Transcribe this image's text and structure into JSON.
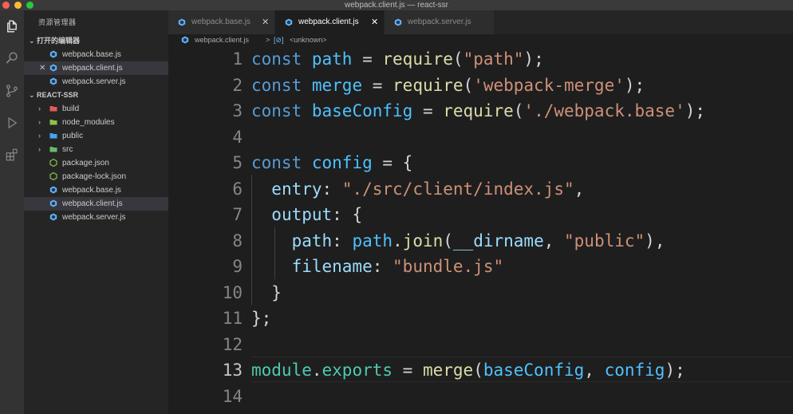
{
  "window": {
    "title": "webpack.client.js — react-ssr"
  },
  "sidebar": {
    "header": "资源管理器",
    "open_editors": {
      "title": "打开的编辑器",
      "items": [
        {
          "label": "webpack.base.js"
        },
        {
          "label": "webpack.client.js"
        },
        {
          "label": "webpack.server.js"
        }
      ],
      "close_glyph": "✕"
    },
    "project": {
      "title": "REACT-SSR",
      "items": [
        {
          "label": "build",
          "kind": "folder",
          "color": "#e05c5c"
        },
        {
          "label": "node_modules",
          "kind": "folder",
          "color": "#8bc34a"
        },
        {
          "label": "public",
          "kind": "folder",
          "color": "#42a5f5"
        },
        {
          "label": "src",
          "kind": "folder",
          "color": "#66bb6a"
        },
        {
          "label": "package.json",
          "kind": "file",
          "color": "#8bc34a"
        },
        {
          "label": "package-lock.json",
          "kind": "file",
          "color": "#8bc34a"
        },
        {
          "label": "webpack.base.js",
          "kind": "file",
          "color": "#64b5f6"
        },
        {
          "label": "webpack.client.js",
          "kind": "file",
          "color": "#64b5f6"
        },
        {
          "label": "webpack.server.js",
          "kind": "file",
          "color": "#64b5f6"
        }
      ]
    }
  },
  "tabs": [
    {
      "label": "webpack.base.js",
      "active": false
    },
    {
      "label": "webpack.client.js",
      "active": true
    },
    {
      "label": "webpack.server.js",
      "active": false
    }
  ],
  "tab_close_glyph": "✕",
  "breadcrumb": {
    "file": "webpack.client.js",
    "separator": ">",
    "symbol_icon": "[⊘]",
    "symbol": "<unknown>"
  },
  "activity_icons": [
    "files-icon",
    "search-icon",
    "source-control-icon",
    "run-debug-icon",
    "extensions-icon"
  ],
  "editor": {
    "line_numbers": [
      "1",
      "2",
      "3",
      "4",
      "5",
      "6",
      "7",
      "8",
      "9",
      "10",
      "11",
      "12",
      "13",
      "14"
    ],
    "lines": [
      [
        [
          "kw",
          "const"
        ],
        [
          "pl",
          " "
        ],
        [
          "var",
          "path"
        ],
        [
          "pl",
          " = "
        ],
        [
          "fn",
          "require"
        ],
        [
          "pl",
          "("
        ],
        [
          "str",
          "\"path\""
        ],
        [
          "pl",
          ");"
        ]
      ],
      [
        [
          "kw",
          "const"
        ],
        [
          "pl",
          " "
        ],
        [
          "var",
          "merge"
        ],
        [
          "pl",
          " = "
        ],
        [
          "fn",
          "require"
        ],
        [
          "pl",
          "("
        ],
        [
          "str",
          "'webpack-merge'"
        ],
        [
          "pl",
          ");"
        ]
      ],
      [
        [
          "kw",
          "const"
        ],
        [
          "pl",
          " "
        ],
        [
          "var",
          "baseConfig"
        ],
        [
          "pl",
          " = "
        ],
        [
          "fn",
          "require"
        ],
        [
          "pl",
          "("
        ],
        [
          "str",
          "'./webpack.base'"
        ],
        [
          "pl",
          ");"
        ]
      ],
      [],
      [
        [
          "kw",
          "const"
        ],
        [
          "pl",
          " "
        ],
        [
          "var",
          "config"
        ],
        [
          "pl",
          " = {"
        ]
      ],
      [
        [
          "pl",
          "  "
        ],
        [
          "prop",
          "entry"
        ],
        [
          "pl",
          ": "
        ],
        [
          "str",
          "\"./src/client/index.js\""
        ],
        [
          "pl",
          ","
        ]
      ],
      [
        [
          "pl",
          "  "
        ],
        [
          "prop",
          "output"
        ],
        [
          "pl",
          ": {"
        ]
      ],
      [
        [
          "pl",
          "    "
        ],
        [
          "prop",
          "path"
        ],
        [
          "pl",
          ": "
        ],
        [
          "var",
          "path"
        ],
        [
          "pl",
          "."
        ],
        [
          "fn",
          "join"
        ],
        [
          "pl",
          "("
        ],
        [
          "prop",
          "__dirname"
        ],
        [
          "pl",
          ", "
        ],
        [
          "str",
          "\"public\""
        ],
        [
          "pl",
          "),"
        ]
      ],
      [
        [
          "pl",
          "    "
        ],
        [
          "prop",
          "filename"
        ],
        [
          "pl",
          ": "
        ],
        [
          "str",
          "\"bundle.js\""
        ]
      ],
      [
        [
          "pl",
          "  }"
        ]
      ],
      [
        [
          "pl",
          "};"
        ]
      ],
      [],
      [
        [
          "mod",
          "module"
        ],
        [
          "pl",
          "."
        ],
        [
          "mod",
          "exports"
        ],
        [
          "pl",
          " = "
        ],
        [
          "fn",
          "merge"
        ],
        [
          "pl",
          "("
        ],
        [
          "var",
          "baseConfig"
        ],
        [
          "pl",
          ", "
        ],
        [
          "var",
          "config"
        ],
        [
          "pl",
          ");"
        ]
      ],
      []
    ],
    "colors": {
      "kw": "#569cd6",
      "var": "#4fc1ff",
      "fn": "#dcdcaa",
      "str": "#ce9178",
      "prop": "#9cdcfe",
      "pl": "#d4d4d4",
      "mod": "#4ec9b0"
    }
  }
}
